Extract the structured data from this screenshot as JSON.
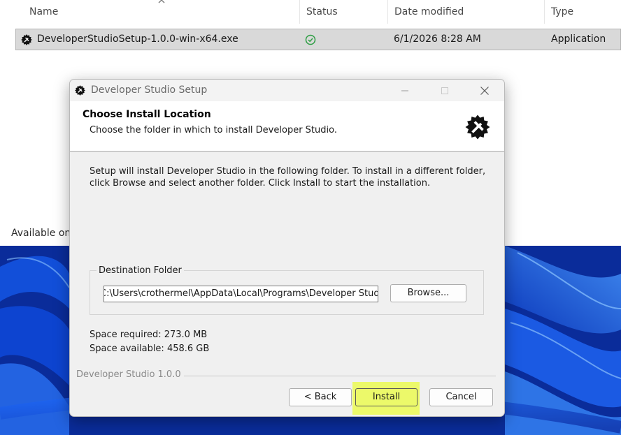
{
  "explorer": {
    "columns": [
      "Name",
      "Status",
      "Date modified",
      "Type"
    ],
    "file": {
      "name": "DeveloperStudioSetup-1.0.0-win-x64.exe",
      "status_icon": "synced-check-icon",
      "date": "6/1/2026 8:28 AM",
      "type": "Application"
    },
    "footer_text": "Available on"
  },
  "dialog": {
    "title": "Developer Studio Setup",
    "header_title": "Choose Install Location",
    "header_subtitle": "Choose the folder in which to install Developer Studio.",
    "body": "Setup will install Developer Studio in the following folder. To install in a different folder, click Browse and select another folder. Click Install to start the installation.",
    "group_label": "Destination Folder",
    "path_value": "C:\\Users\\crothermel\\AppData\\Local\\Programs\\Developer Studio",
    "browse_label": "Browse...",
    "space_required": "Space required: 273.0 MB",
    "space_available": "Space available: 458.6 GB",
    "branding": "Developer Studio 1.0.0",
    "back_label": "< Back",
    "install_label": "Install",
    "cancel_label": "Cancel"
  },
  "colors": {
    "highlight": "#ecf96a",
    "wallpaper": "#0b3cc4",
    "status_green": "#2e9e44"
  }
}
